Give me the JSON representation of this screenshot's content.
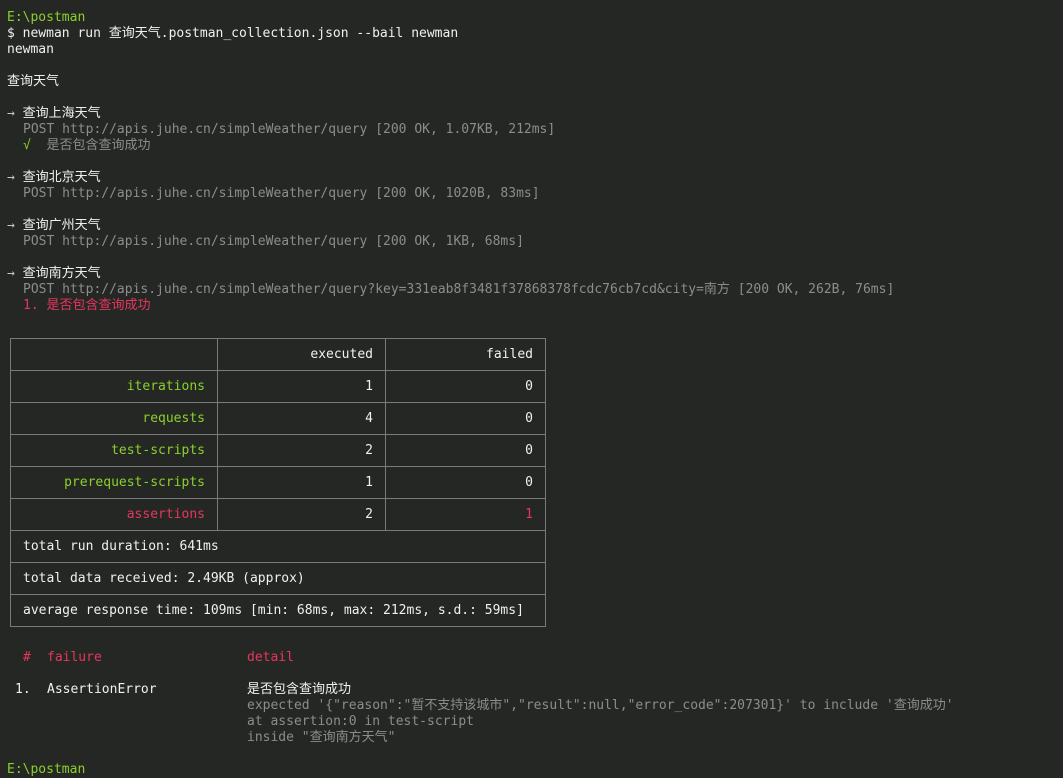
{
  "prompt": {
    "cwd": "E:\\postman",
    "command": "$ newman run 查询天气.postman_collection.json --bail newman",
    "app": "newman",
    "next_cwd": "E:\\postman"
  },
  "collection": "查询天气",
  "arrow": "→",
  "check": "√",
  "requests": [
    {
      "name": "查询上海天气",
      "line": "POST http://apis.juhe.cn/simpleWeather/query [200 OK, 1.07KB, 212ms]",
      "assertion": "是否包含查询成功"
    },
    {
      "name": "查询北京天气",
      "line": "POST http://apis.juhe.cn/simpleWeather/query [200 OK, 1020B, 83ms]"
    },
    {
      "name": "查询广州天气",
      "line": "POST http://apis.juhe.cn/simpleWeather/query [200 OK, 1KB, 68ms]"
    },
    {
      "name": "查询南方天气",
      "line": "POST http://apis.juhe.cn/simpleWeather/query?key=331eab8f3481f37868378fcdc76cb7cd&city=南方 [200 OK, 262B, 76ms]",
      "failed_assertion": "1. 是否包含查询成功"
    }
  ],
  "summary": {
    "headers": [
      "",
      "executed",
      "failed"
    ],
    "rows": [
      {
        "label": "iterations",
        "executed": "1",
        "failed": "0"
      },
      {
        "label": "requests",
        "executed": "4",
        "failed": "0"
      },
      {
        "label": "test-scripts",
        "executed": "2",
        "failed": "0"
      },
      {
        "label": "prerequest-scripts",
        "executed": "1",
        "failed": "0"
      },
      {
        "label": "assertions",
        "executed": "2",
        "failed": "1"
      }
    ],
    "duration": "total run duration: 641ms",
    "data_received": "total data received: 2.49KB (approx)",
    "avg_response": "average response time: 109ms [min: 68ms, max: 212ms, s.d.: 59ms]"
  },
  "failures": {
    "header_num": "#",
    "header_failure": "failure",
    "header_detail": "detail",
    "items": [
      {
        "num": "1.",
        "type": "AssertionError",
        "title": "是否包含查询成功",
        "expected": "expected '{\"reason\":\"暂不支持该城市\",\"result\":null,\"error_code\":207301}' to include '查询成功'",
        "at": "at assertion:0 in test-script",
        "inside": "inside \"查询南方天气\""
      }
    ]
  },
  "colors": {
    "background": "#252725",
    "prompt_green": "#8bd12a",
    "error_red": "#e8365b",
    "dim_gray": "#8c8c8c"
  }
}
